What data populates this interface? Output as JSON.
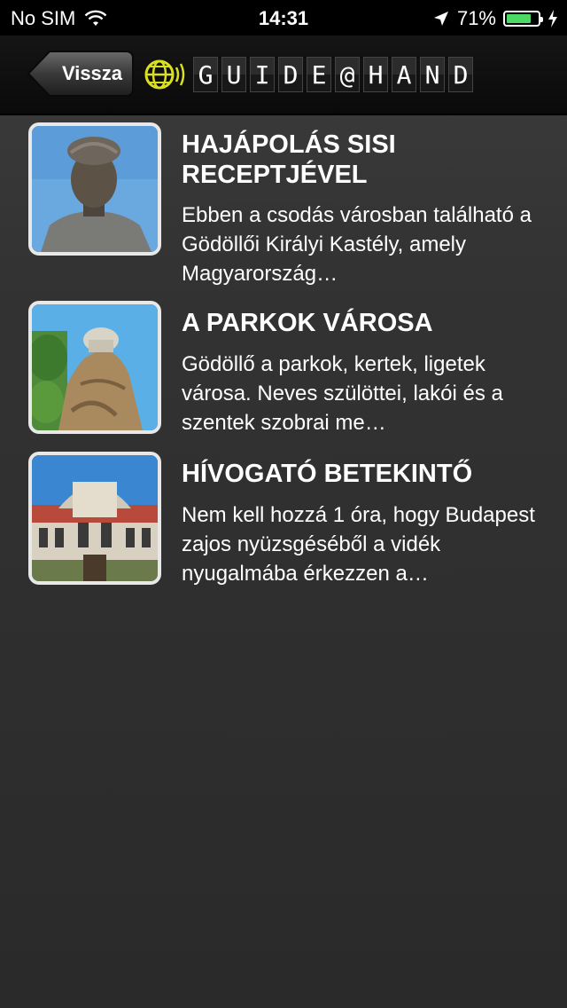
{
  "status_bar": {
    "carrier": "No SIM",
    "time": "14:31",
    "battery": "71%",
    "wifi_icon": "wifi-icon",
    "location_icon": "location-arrow-icon",
    "charging_icon": "charging-bolt-icon",
    "battery_color": "#4cd964"
  },
  "nav": {
    "back_label": "Vissza",
    "logo_text": [
      "G",
      "U",
      "I",
      "D",
      "E",
      "@",
      "H",
      "A",
      "N",
      "D"
    ],
    "logo_icon": "globe-sound-icon",
    "logo_color": "#d8e020"
  },
  "items": [
    {
      "title": "HAJÁPOLÁS SISI RECEPTJÉVEL",
      "description": "Ebben a csodás városban található a Gödöllői Királyi Kastély, amely Magyarország…",
      "image": "statue-bust-image"
    },
    {
      "title": "A PARKOK VÁROSA",
      "description": "Gödöllő a parkok, kertek, ligetek városa. Neves szülöttei, lakói és a szentek szobrai me…",
      "image": "rock-monument-image"
    },
    {
      "title": "HÍVOGATÓ BETEKINTŐ",
      "description": "Nem kell hozzá 1 óra, hogy Budapest zajos nyüzsgéséből a vidék nyugalmába érkezzen a…",
      "image": "palace-facade-image"
    }
  ]
}
